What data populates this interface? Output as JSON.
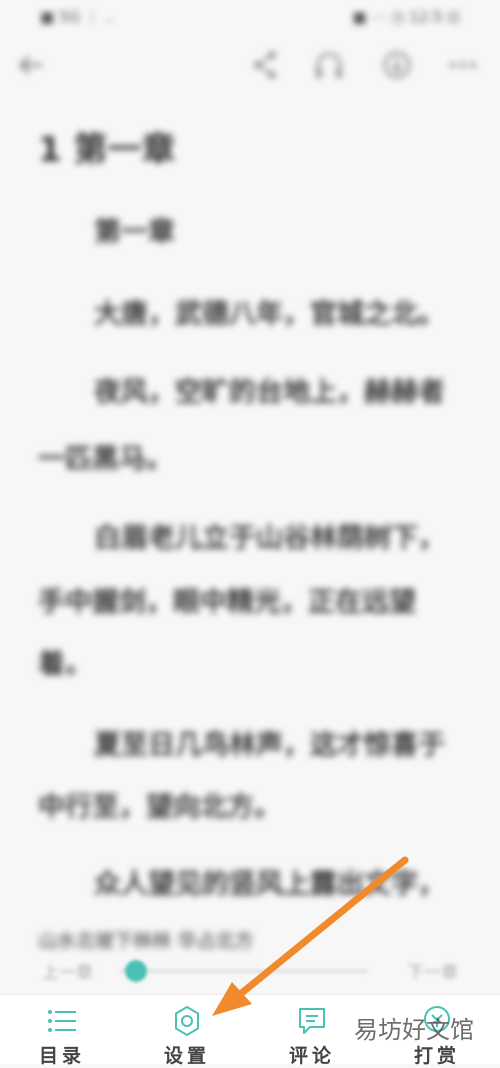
{
  "status_bar": {
    "left": "■ 5G ⋮ ..",
    "right": "■ ⋯ ◷ 12:5 ⊡"
  },
  "top_bar": {
    "back_icon": "arrow-left-icon",
    "share_icon": "share-icon",
    "listen_icon": "headphones-icon",
    "download_icon": "download-icon",
    "more_icon": "more-icon"
  },
  "reader": {
    "chapter_title": "1 第一章",
    "paragraphs": [
      "第一章",
      "大唐，武德八年，官城之北。",
      "夜风，空旷的台地上，赫赫者",
      "一匹黑马。",
      "白眉老儿立于山谷林荫树下，",
      "手中握剑，眼中精光，正在远望",
      "着。",
      "夏至日几鸟林声，这才惊喜于",
      "中行至，望向北方。",
      "众人望见的竖风上露出文字，"
    ],
    "partial_line": "山水北坡下林林    华占北方"
  },
  "progress": {
    "prev_label": "上一章",
    "next_label": "下一章",
    "value": 0.02,
    "accent": "#49c1b6"
  },
  "bottom_nav": [
    {
      "label": "目录",
      "icon": "list-icon"
    },
    {
      "label": "设置",
      "icon": "gear-icon"
    },
    {
      "label": "评论",
      "icon": "comment-icon"
    },
    {
      "label": "打赏",
      "icon": "reward-icon"
    }
  ],
  "watermark": "易坊好文馆",
  "annotation": {
    "color": "#f08a2c"
  }
}
